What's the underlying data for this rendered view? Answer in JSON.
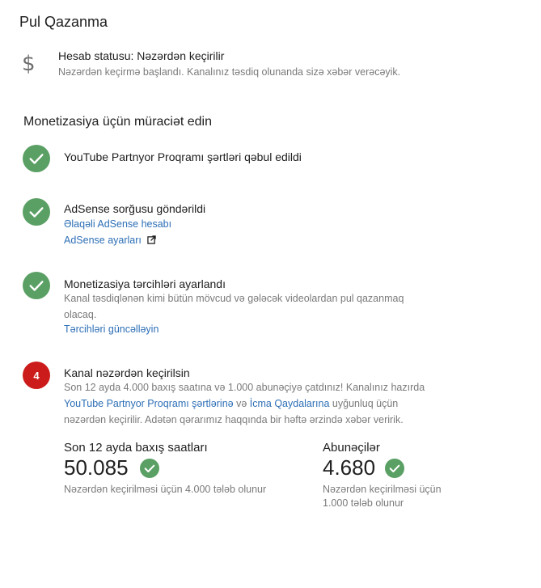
{
  "page": {
    "title": "Pul Qazanma"
  },
  "status": {
    "icon": "dollar-icon",
    "title": "Hesab statusu: Nəzərdən keçirilir",
    "description": "Nəzərdən keçirmə başlandı. Kanalınız təsdiq olunanda sizə xəbər verəcəyik."
  },
  "monetization": {
    "heading": "Monetizasiya üçün müraciət edin",
    "steps": [
      {
        "state": "done",
        "icon": "check-icon",
        "title": "YouTube Partnyor Proqramı şərtləri qəbul edildi"
      },
      {
        "state": "done",
        "icon": "check-icon",
        "title": "AdSense sorğusu göndərildi",
        "links": [
          "Əlaqəli AdSense hesabı",
          "AdSense ayarları"
        ]
      },
      {
        "state": "done",
        "icon": "check-icon",
        "title": "Monetizasiya tərcihləri ayarlandı",
        "description_line1": "Kanal təsdiqlənən kimi bütün mövcud və gələcək videolardan pul qazanmaq",
        "description_line2": "olacaq.",
        "link": "Tərcihləri güncəlləyin"
      },
      {
        "state": "pending",
        "number": "4",
        "title": "Kanal nəzərdən keçirilsin",
        "line1": "Son 12 ayda 4.000 baxış saatına və 1.000 abunəçiyə çatdınız! Kanalınız hazırda",
        "line2_link1": "YouTube Partnyor Proqramı şərtlərinə",
        "line2_mid": " və ",
        "line2_link2": "İcma Qaydalarına",
        "line2_end": " uyğunluq üçün",
        "line3": "nəzərdən keçirilir. Adətən qərarımız haqqında bir həftə ərzində xəbər veririk."
      }
    ]
  },
  "stats": {
    "watch_hours": {
      "label": "Son 12 ayda baxış saatları",
      "value": "50.085",
      "note": "Nəzərdən keçirilməsi üçün 4.000 tələb olunur"
    },
    "subscribers": {
      "label": "Abunəçilər",
      "value": "4.680",
      "note_line1": "Nəzərdən keçirilməsi üçün",
      "note_line2": "1.000 tələb olunur"
    }
  },
  "colors": {
    "success": "#5aa064",
    "pending": "#cc1b1b",
    "link": "#2d6fb6"
  }
}
